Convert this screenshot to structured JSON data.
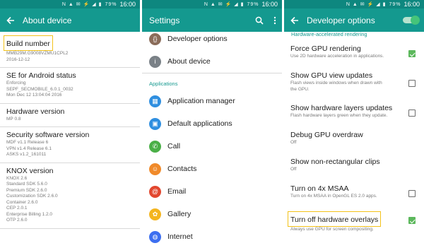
{
  "status": {
    "time": "16:00",
    "battery": "79%",
    "icons": "N ▲ ✉ ⚡ ◢ ▮"
  },
  "panel1": {
    "title": "About device",
    "items": [
      {
        "title": "Build number",
        "sub": [
          "MMB29M.G9008VZMU1CPL2",
          "2016-12-12"
        ],
        "highlight": true
      },
      {
        "title": "SE for Android status",
        "sub": [
          "Enforcing",
          "SEPF_SECMOBILE_6.0.1_0032",
          "Mon Dec 12 13:04:04 2016"
        ]
      },
      {
        "title": "Hardware version",
        "sub": [
          "MP 0.8"
        ]
      },
      {
        "title": "Security software version",
        "sub": [
          "MDF v1.1 Release 6",
          "VPN v1.4 Release 6.1",
          "ASKS v1.2_161011"
        ]
      },
      {
        "title": "KNOX version",
        "sub": [
          "KNOX 2.6",
          "Standard SDK 5.6.0",
          "Premium SDK 2.6.0",
          "Customization SDK 2.6.0",
          "Container 2.6.0",
          "CEP 2.0.1",
          "Enterprise Billing 1.2.0",
          "OTP 2.6.0"
        ]
      }
    ]
  },
  "panel2": {
    "title": "Settings",
    "top_items": [
      {
        "label": "Developer options",
        "icon": "developer-options-icon",
        "color": "#8a6c5a",
        "glyph": "{}"
      },
      {
        "label": "About device",
        "icon": "about-device-icon",
        "color": "#7a8187",
        "glyph": "i"
      }
    ],
    "section": "Applications",
    "app_items": [
      {
        "label": "Application manager",
        "icon": "application-manager-icon",
        "color": "#2f8fe0",
        "glyph": "▦"
      },
      {
        "label": "Default applications",
        "icon": "default-applications-icon",
        "color": "#2f8fe0",
        "glyph": "▣"
      },
      {
        "label": "Call",
        "icon": "call-icon",
        "color": "#4aaf47",
        "glyph": "✆"
      },
      {
        "label": "Contacts",
        "icon": "contacts-icon",
        "color": "#f08a2a",
        "glyph": "☺"
      },
      {
        "label": "Email",
        "icon": "email-icon",
        "color": "#e2472f",
        "glyph": "@"
      },
      {
        "label": "Gallery",
        "icon": "gallery-icon",
        "color": "#f4b51f",
        "glyph": "✿"
      },
      {
        "label": "Internet",
        "icon": "internet-icon",
        "color": "#3d6ff0",
        "glyph": "◍"
      }
    ]
  },
  "panel3": {
    "title": "Developer options",
    "toggle_on": true,
    "section": "Hardware-accelerated rendering",
    "items": [
      {
        "title": "Force GPU rendering",
        "sub": [
          "Use 2D hardware acceleration in applications."
        ],
        "checkbox": "on"
      },
      {
        "title": "Show GPU view updates",
        "sub": [
          "Flash views inside windows when drawn with",
          "the GPU."
        ],
        "checkbox": "off"
      },
      {
        "title": "Show hardware layers updates",
        "sub": [
          "Flash hardware layers green when they update."
        ],
        "checkbox": "off"
      },
      {
        "title": "Debug GPU overdraw",
        "sub": [
          "Off"
        ],
        "checkbox": "none"
      },
      {
        "title": "Show non-rectangular clips",
        "sub": [
          "Off"
        ],
        "checkbox": "none"
      },
      {
        "title": "Turn on 4x MSAA",
        "sub": [
          "Turn on 4x MSAA in OpenGL ES 2.0 apps."
        ],
        "checkbox": "off"
      },
      {
        "title": "Turn off hardware overlays",
        "sub": [
          "Always use GPU for screen compositing."
        ],
        "checkbox": "on",
        "highlight": true
      }
    ]
  }
}
